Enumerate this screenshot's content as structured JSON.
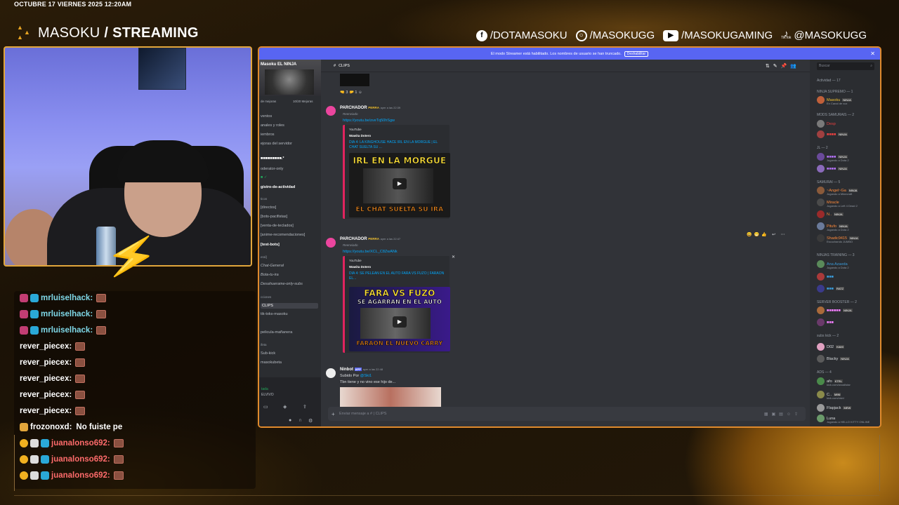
{
  "overlay": {
    "datetime": "OCTUBRE 17 VIERNES 2025 12:20AM",
    "brand_name": "MASOKU",
    "brand_sep": " / ",
    "brand_tag": "STREAMING",
    "socials": [
      {
        "icon": "facebook-icon",
        "label": "/DOTAMASOKU"
      },
      {
        "icon": "instagram-icon",
        "label": "/MASOKUGG"
      },
      {
        "icon": "youtube-icon",
        "label": "/MASOKUGAMING"
      },
      {
        "icon": "tiktok-icon",
        "label": "@MASOKUGG",
        "sub": "TikTok"
      }
    ],
    "accent": "#e2a63b"
  },
  "chat": [
    {
      "user": "mrluiselhack:",
      "color": "#7fd8e8",
      "msg": "",
      "badges": 2
    },
    {
      "user": "mrluiselhack:",
      "color": "#7fd8e8",
      "msg": "",
      "badges": 2
    },
    {
      "user": "mrluiselhack:",
      "color": "#7fd8e8",
      "msg": "",
      "badges": 2
    },
    {
      "user": "rever_piecex:",
      "color": "#ffffff",
      "msg": "",
      "badges": 0
    },
    {
      "user": "rever_piecex:",
      "color": "#ffffff",
      "msg": "",
      "badges": 0
    },
    {
      "user": "rever_piecex:",
      "color": "#ffffff",
      "msg": "",
      "badges": 0
    },
    {
      "user": "rever_piecex:",
      "color": "#ffffff",
      "msg": "",
      "badges": 0
    },
    {
      "user": "rever_piecex:",
      "color": "#ffffff",
      "msg": "",
      "badges": 0
    },
    {
      "user": "frozonoxd:",
      "color": "#ffffff",
      "msg": "No fuiste pe",
      "badges": 1
    },
    {
      "user": "juanalonso692:",
      "color": "#ff6b6b",
      "msg": "",
      "badges": 3
    },
    {
      "user": "juanalonso692:",
      "color": "#ff6b6b",
      "msg": "",
      "badges": 3
    },
    {
      "user": "juanalonso692:",
      "color": "#ff6b6b",
      "msg": "",
      "badges": 3
    }
  ],
  "discord": {
    "banner": "El modo Streamer está habilitado. Los nombres de usuario se han truncado.",
    "banner_button": "Deshabilitar",
    "server": {
      "name": "Masoku EL NINJA",
      "boost": "de mejoras",
      "boost_count": "10/20 Mejoras",
      "top": [
        "ventos",
        "anales y roles",
        "iembros",
        "ejoras del servidor"
      ],
      "channels": [
        "oderator-only",
        "gistro-de-actividad",
        "[directos]",
        "[bots-pacifistas]",
        "[venta-de-teclados]",
        "[anime-recomendaciones]",
        "[test-bots]",
        "Chat-General",
        "Bota-tu-ira",
        "Desahuerame-only-subs",
        "CLIPS",
        "tik-toks-masoku",
        "pelicula-mañanera",
        "Sub-kick",
        "masokubeta"
      ],
      "cats": [
        "eral]",
        "ticos",
        "cciones",
        "ifeta"
      ]
    },
    "userbar": {
      "name": "tada",
      "status": "ELVIVO"
    },
    "channel_title": "CLIPS",
    "search_placeholder": "Buscar",
    "messages": [
      {
        "author": "PARCHADOR",
        "badge": "PERRA",
        "time": "ayer a las 22:39",
        "forward": "Reenviado",
        "url": "https://youtu.be/zveTq50hSgw",
        "provider": "YouTube",
        "channel": "Wawita Dotero",
        "title": "DIA 4: LA KINGHOUSE HACE IRL EN LA MORGUE | EL CHAT SUELTA SU ...",
        "thumb_top": "IRL EN LA MORGUE",
        "thumb_bottom": "EL CHAT SUELTA SU IRA"
      },
      {
        "author": "PARCHADOR",
        "badge": "PERRA",
        "time": "ayer a las 22:47",
        "forward": "Reenviado",
        "url": "https://youtu.be/XCL_C8ZwANk",
        "provider": "YouTube",
        "channel": "Wawita Dotero",
        "title": "DIA 4: SE PELEAN EN EL AUTO FARA VS FUZO | FARAON EL...",
        "thumb_top": "FARA VS FUZO",
        "thumb_mid": "SE AGARRAN EN EL AUTO",
        "thumb_bottom": "FARAON EL NUEVO CARRY"
      },
      {
        "author": "Ninbot",
        "badge": "APP",
        "time": "ayer a las 22:48",
        "line1": "Subido Por",
        "mention": "@Ski1",
        "line2": "Tbn tiene y no vino ese hijo de..."
      }
    ],
    "reactions": [
      "3",
      "1"
    ],
    "composer": "Enviar mensaje a # | CLIPS",
    "members": {
      "header": "Actividad — 17",
      "groups": [
        {
          "cat": "NINJA SUPREMO — 1",
          "items": [
            {
              "name": "Masoku",
              "tag": "NINJA",
              "sub": "En Canal de voz",
              "color": "#f0c030"
            }
          ]
        },
        {
          "cat": "MODS SAMURAIS — 2",
          "items": [
            {
              "name": "Desp",
              "tag": "",
              "sub": "",
              "color": "#e84040"
            },
            {
              "name": "",
              "tag": "NINJA",
              "sub": "",
              "color": "#e84040"
            }
          ]
        },
        {
          "cat": "JL — 2",
          "items": [
            {
              "name": "",
              "tag": "NINJA",
              "sub": "Jugando a Dota 2",
              "color": "#b070f0"
            },
            {
              "name": "",
              "tag": "NINJA",
              "sub": "",
              "color": "#b070f0"
            }
          ]
        },
        {
          "cat": "SAMURAI — 5",
          "items": [
            {
              "name": "~Angel~Ga",
              "tag": "NINJA",
              "sub": "Jugando a Minecraft",
              "color": "#ff8a3a"
            },
            {
              "name": "Miracle",
              "tag": "",
              "sub": "Jugando a Left 4 Dead 2",
              "color": "#ff8a3a"
            },
            {
              "name": "N..",
              "tag": "NINJA",
              "sub": "",
              "color": "#ff8a3a"
            },
            {
              "name": "Pitufo",
              "tag": "NINJA",
              "sub": "Jugando a Dota 2",
              "color": "#ff8a3a"
            },
            {
              "name": "Shadic9415",
              "tag": "NINJA",
              "sub": "Escuchando JUMBO",
              "color": "#ff8a3a"
            }
          ]
        },
        {
          "cat": "NINJAS TRAINING — 3",
          "items": [
            {
              "name": "Ana Azaeda",
              "tag": "",
              "sub": "Jugando a Dota 2",
              "color": "#3a9ad8"
            },
            {
              "name": "",
              "tag": "",
              "sub": "",
              "color": "#3a9ad8"
            },
            {
              "name": "",
              "tag": "RATZ",
              "sub": "",
              "color": "#3a9ad8"
            }
          ]
        },
        {
          "cat": "SERVER BOOSTER — 2",
          "items": [
            {
              "name": "",
              "tag": "NINJA",
              "sub": "",
              "color": "#f47fff"
            },
            {
              "name": "",
              "tag": "",
              "sub": "",
              "color": "#f47fff"
            }
          ]
        },
        {
          "cat": "subs kick — 2",
          "items": [
            {
              "name": "D02",
              "tag": "KAMI",
              "sub": "",
              "color": "#dbdee1"
            },
            {
              "name": "Blacky",
              "tag": "NINJA",
              "sub": "",
              "color": "#dbdee1"
            }
          ]
        },
        {
          "cat": "ADS — 4",
          "items": [
            {
              "name": "afo",
              "tag": "KTRL",
              "sub": "kick.com/axoallstar",
              "color": "#dbdee1"
            },
            {
              "name": "C..",
              "tag": "MINI",
              "sub": "kick.com/xisbl",
              "color": "#dbdee1"
            },
            {
              "name": "Flapjack",
              "tag": "MEW",
              "sub": "",
              "color": "#dbdee1"
            },
            {
              "name": "Luna",
              "tag": "",
              "sub": "Jugando a HELLO KITTY ONLINE",
              "color": "#dbdee1"
            }
          ]
        }
      ]
    }
  }
}
